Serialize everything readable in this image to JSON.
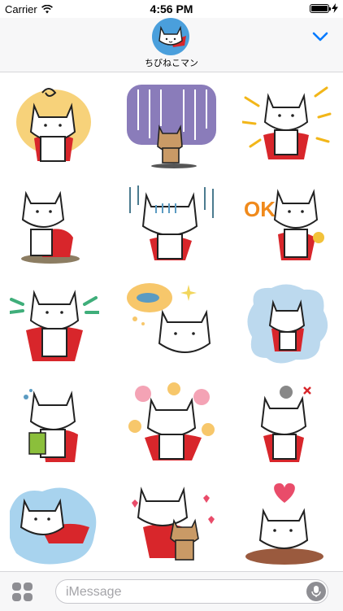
{
  "status_bar": {
    "carrier": "Carrier",
    "time": "4:56 PM"
  },
  "header": {
    "app_name": "ちびねこマン"
  },
  "stickers": [
    {
      "name": "cat-dizzy"
    },
    {
      "name": "cat-rain-sad"
    },
    {
      "name": "cat-excited"
    },
    {
      "name": "cat-thinking"
    },
    {
      "name": "cat-gloomy"
    },
    {
      "name": "cat-ok",
      "caption": "OK!"
    },
    {
      "name": "cat-cheer"
    },
    {
      "name": "cat-dream-fish"
    },
    {
      "name": "cat-crying"
    },
    {
      "name": "cat-book"
    },
    {
      "name": "cat-flowers"
    },
    {
      "name": "cat-angry"
    },
    {
      "name": "cat-flying"
    },
    {
      "name": "cat-hug"
    },
    {
      "name": "cat-love"
    }
  ],
  "composer": {
    "placeholder": "iMessage"
  },
  "colors": {
    "accent": "#007aff",
    "cape": "#d8262b",
    "cat": "#ffffff"
  }
}
